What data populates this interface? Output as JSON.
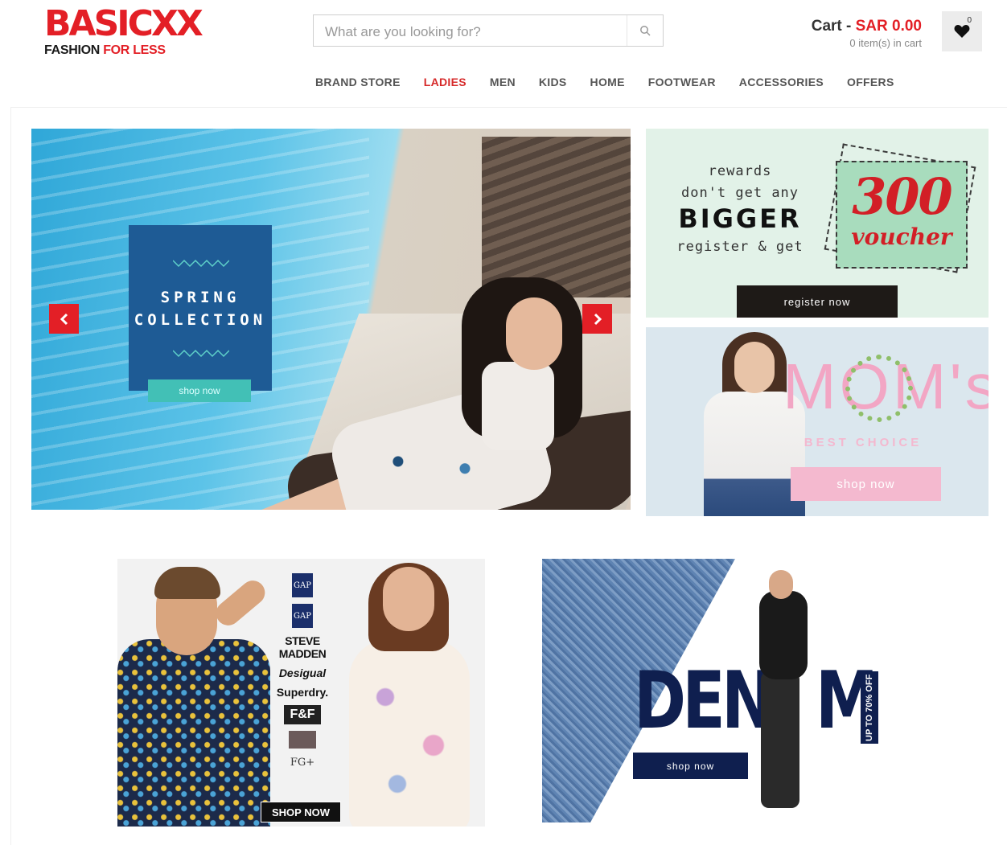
{
  "header": {
    "logo_main": "BASICXX",
    "logo_tag_black": "FASHION",
    "logo_tag_red": "FOR LESS",
    "search_placeholder": "What are you looking for?",
    "cart_label": "Cart - ",
    "cart_amount": "SAR 0.00",
    "cart_items": "0 item(s) in cart",
    "wishlist_count": "0"
  },
  "nav": [
    {
      "label": "BRAND STORE",
      "active": false
    },
    {
      "label": "LADIES",
      "active": true
    },
    {
      "label": "MEN",
      "active": false
    },
    {
      "label": "KIDS",
      "active": false
    },
    {
      "label": "HOME",
      "active": false
    },
    {
      "label": "FOOTWEAR",
      "active": false
    },
    {
      "label": "ACCESSORIES",
      "active": false
    },
    {
      "label": "OFFERS",
      "active": false
    }
  ],
  "hero": {
    "title_line1": "SPRING",
    "title_line2": "COLLECTION",
    "button": "shop now"
  },
  "rewards": {
    "line1": "rewards",
    "line2": "don't get any",
    "line3": "BIGGER",
    "line4": "register & get",
    "voucher_amount": "300",
    "voucher_word": "voucher",
    "button": "register now"
  },
  "moms": {
    "title": "MOM's",
    "subtitle": "BEST CHOICE",
    "button": "shop now"
  },
  "brands": {
    "gap1": "GAP",
    "gap2": "GAP",
    "steve": "STEVE MADDEN",
    "desigual": "Desigual",
    "superdry": "Superdry.",
    "ff": "F&F",
    "fg": "FG+",
    "button": "SHOP NOW"
  },
  "denim": {
    "word_left": "DEN",
    "word_right": "M",
    "vertical": "UP TO 70% OFF",
    "button": "shop now"
  },
  "colors": {
    "brand_red": "#e31f26",
    "spring_blue": "#1e5b95",
    "denim_navy": "#0f1f4f"
  }
}
